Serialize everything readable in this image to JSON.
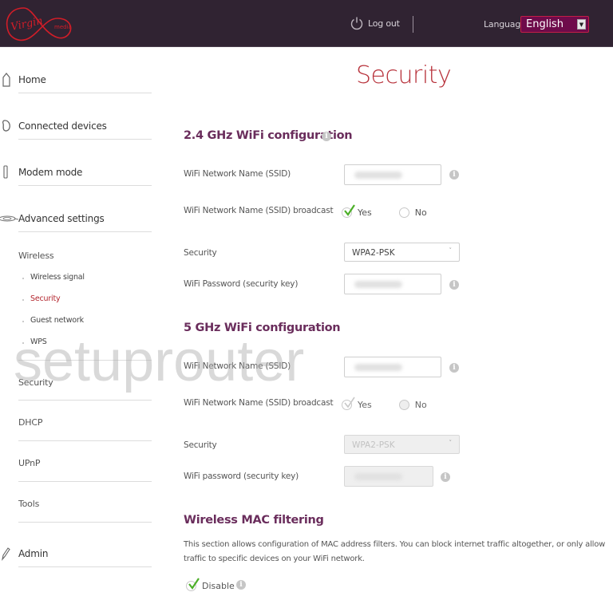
{
  "header": {
    "brand": "Virgin media",
    "logout_label": "Log out",
    "language_label": "Language",
    "language_value": "English"
  },
  "sidebar": {
    "main_items": [
      {
        "label": "Home",
        "icon": "home-icon"
      },
      {
        "label": "Connected devices",
        "icon": "devices-icon"
      },
      {
        "label": "Modem mode",
        "icon": "modem-icon"
      },
      {
        "label": "Advanced settings",
        "icon": "advanced-settings-icon"
      }
    ],
    "wireless_label": "Wireless",
    "wireless_items": [
      {
        "label": "Wireless signal",
        "active": false
      },
      {
        "label": "Security",
        "active": true
      },
      {
        "label": "Guest network",
        "active": false
      },
      {
        "label": "WPS",
        "active": false
      }
    ],
    "advanced_items": [
      {
        "label": "Security"
      },
      {
        "label": "DHCP"
      },
      {
        "label": "UPnP"
      },
      {
        "label": "Tools"
      }
    ],
    "admin_label": "Admin"
  },
  "main": {
    "title": "Security",
    "band24": {
      "title": "2.4 GHz WiFi configuration",
      "ssid_label": "WiFi Network Name (SSID)",
      "broadcast_label": "WiFi Network Name (SSID) broadcast",
      "broadcast_yes": "Yes",
      "broadcast_no": "No",
      "broadcast_value": "Yes",
      "security_label": "Security",
      "security_value": "WPA2-PSK",
      "password_label": "WiFi Password (security key)"
    },
    "band5": {
      "title": "5 GHz WiFi configuration",
      "ssid_label": "WiFi Network Name (SSID)",
      "broadcast_label": "WiFi Network Name (SSID) broadcast",
      "broadcast_yes": "Yes",
      "broadcast_no": "No",
      "broadcast_value": "Yes",
      "security_label": "Security",
      "security_value": "WPA2-PSK",
      "password_label": "WiFi password (security key)"
    },
    "mac_filter": {
      "title": "Wireless MAC filtering",
      "description": "This section allows configuration of MAC address filters. You can block internet traffic altogether, or only allow traffic to specific devices on your WiFi network.",
      "disable_label": "Disable",
      "disable_checked": true
    }
  },
  "watermark": "setuprouter",
  "colors": {
    "header_bg": "#302332",
    "accent_red": "#b8333c",
    "section_purple": "#6a2d5c",
    "check_green": "#4caf28"
  }
}
